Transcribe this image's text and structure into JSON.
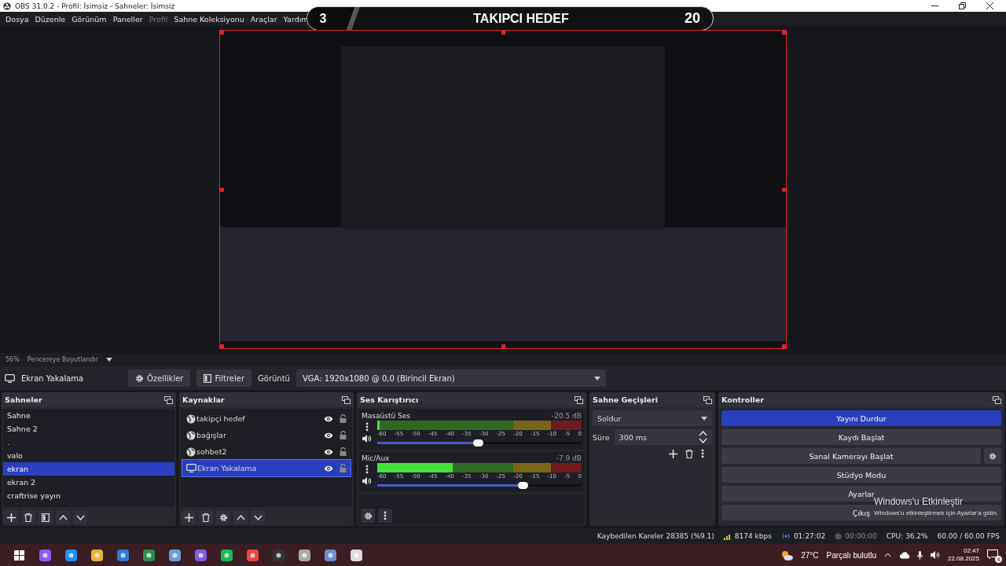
{
  "window": {
    "title": "OBS 31.0.2 - Profil: İsimsiz - Sahneler: İsimsiz"
  },
  "menu": [
    {
      "label": "Dosya",
      "disabled": false
    },
    {
      "label": "Düzenle",
      "disabled": false
    },
    {
      "label": "Görünüm",
      "disabled": false
    },
    {
      "label": "Paneller",
      "disabled": false
    },
    {
      "label": "Profil",
      "disabled": true
    },
    {
      "label": "Sahne Koleksiyonu",
      "disabled": false
    },
    {
      "label": "Araçlar",
      "disabled": false
    },
    {
      "label": "Yardım",
      "disabled": false
    }
  ],
  "follower_overlay": {
    "current": "3",
    "title": "TAKIPCI HEDEF",
    "goal": "20"
  },
  "preview_bar": {
    "zoom": "56%",
    "scale_mode": "Pencereye Boyutlandır"
  },
  "source_toolbar": {
    "source": "Ekran Yakalama",
    "properties": "Özellikler",
    "filters": "Filtreler",
    "display_label": "Görüntü",
    "display": "VGA: 1920x1080 @ 0,0 (Birincil Ekran)"
  },
  "scenes": {
    "title": "Sahneler",
    "items": [
      {
        "label": "Sahne",
        "selected": false
      },
      {
        "label": "Sahne 2",
        "selected": false
      },
      {
        "label": ".",
        "selected": false
      },
      {
        "label": "valo",
        "selected": false
      },
      {
        "label": "ekran",
        "selected": true
      },
      {
        "label": "ekran 2",
        "selected": false
      },
      {
        "label": "craftrise yayın",
        "selected": false
      }
    ]
  },
  "sources": {
    "title": "Kaynaklar",
    "items": [
      {
        "label": "takipçi hedef",
        "kind": "browser",
        "visible": true,
        "locked": false,
        "selected": false
      },
      {
        "label": "bağışlar",
        "kind": "browser",
        "visible": true,
        "locked": false,
        "selected": false
      },
      {
        "label": "sohbet2",
        "kind": "browser",
        "visible": true,
        "locked": false,
        "selected": false
      },
      {
        "label": "Ekran Yakalama",
        "kind": "display",
        "visible": true,
        "locked": false,
        "selected": true
      }
    ]
  },
  "mixer": {
    "title": "Ses Karıştırıcı",
    "channels": [
      {
        "name": "Masaüstü Ses",
        "reading": "-20.5 dB",
        "meter": {
          "level": 0.01
        },
        "fader": {
          "level": 0.47
        },
        "scale": [
          "-60",
          "-55",
          "-50",
          "-45",
          "-40",
          "-35",
          "-30",
          "-25",
          "-20",
          "-15",
          "-10",
          "-5",
          "0"
        ]
      },
      {
        "name": "Mic/Aux",
        "reading": "-7.9 dB",
        "meter": {
          "level": 0.37
        },
        "fader": {
          "level": 0.69
        },
        "scale": [
          "-60",
          "-55",
          "-50",
          "-45",
          "-40",
          "-35",
          "-30",
          "-25",
          "-20",
          "-15",
          "-10",
          "-5",
          "0"
        ]
      }
    ]
  },
  "transitions": {
    "title": "Sahne Geçişleri",
    "transition": "Soldur",
    "duration_label": "Süre",
    "duration": "300 ms"
  },
  "controls": {
    "title": "Kontroller",
    "buttons": [
      {
        "label": "Yayını Durdur",
        "active": true,
        "has_settings": false
      },
      {
        "label": "Kaydı Başlat",
        "active": false,
        "has_settings": false
      },
      {
        "label": "Sanal Kamerayı Başlat",
        "active": false,
        "has_settings": true
      },
      {
        "label": "Stüdyo Modu",
        "active": false,
        "has_settings": false
      },
      {
        "label": "Ayarlar",
        "active": false,
        "has_settings": false
      },
      {
        "label": "Çıkış",
        "active": false,
        "has_settings": false
      }
    ]
  },
  "activation_notice": {
    "title": "Windows'u Etkinleştir",
    "message": "Windows'u etkinleştirmek için Ayarlar'a gidin."
  },
  "status_bar": {
    "dropped_frames": "Kaybedilen Kareler 28385 (%9.1)",
    "bitrate": "8174 kbps",
    "stream_time": "01:27:02",
    "record_time": "00:00:00",
    "cpu": "CPU: 36.2%",
    "fps": "60.00 / 60.00 FPS"
  },
  "taskbar": {
    "temperature": "27°C",
    "condition": "Parçalı bulutlu",
    "time": "02:47",
    "date": "22.08.2025",
    "notifications": "4"
  }
}
